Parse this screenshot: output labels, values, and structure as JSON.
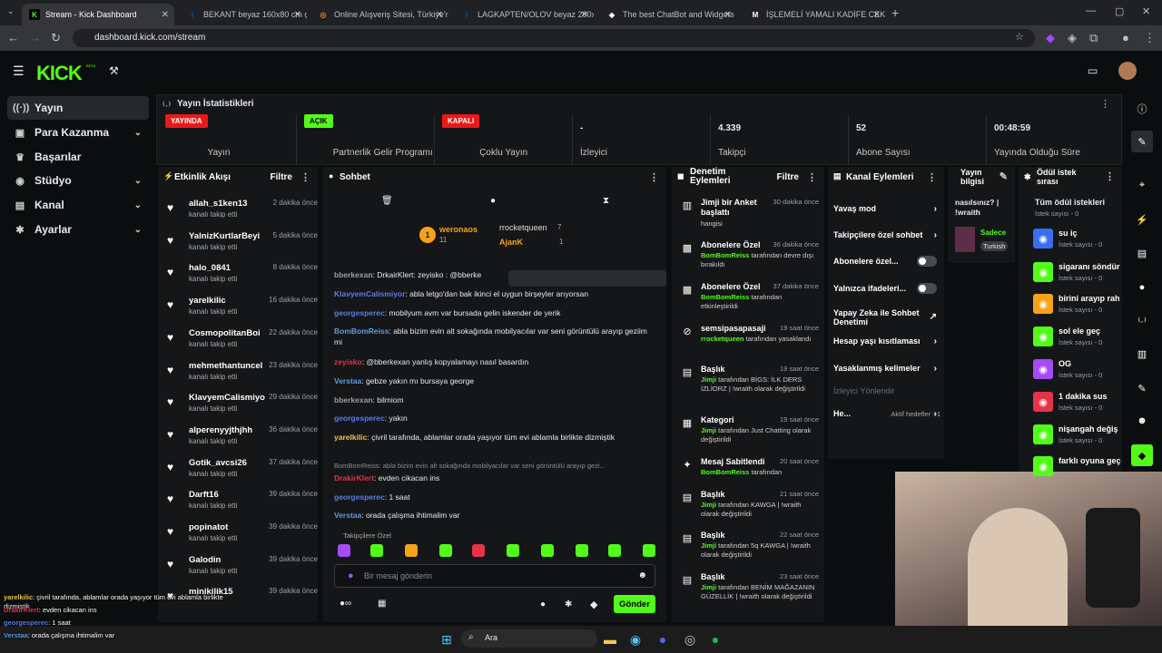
{
  "browser": {
    "tabs": [
      {
        "title": "Stream - Kick Dashboard",
        "fav": "K",
        "color": "#53fc18",
        "active": true
      },
      {
        "title": "BEKANT beyaz 160x80 cm çalış",
        "fav": "I",
        "color": "#0058a3"
      },
      {
        "title": "Online Alışveriş Sitesi, Türkiye'n",
        "fav": "◎",
        "color": "#f27a1a"
      },
      {
        "title": "LAGKAPTEN/OLOV beyaz 200x",
        "fav": "I",
        "color": "#0058a3"
      },
      {
        "title": "The best ChatBot and Widgets",
        "fav": "◆",
        "color": "#ffffff"
      },
      {
        "title": "İŞLEMELİ YAMALI KADİFE CEKE",
        "fav": "M",
        "color": "#ffffff"
      }
    ],
    "url": "dashboard.kick.com/stream"
  },
  "header": {
    "logo": "KICK",
    "beta": "BETA"
  },
  "sidebar": {
    "items": [
      {
        "label": "Yayın",
        "icon": "broadcast-icon",
        "glyph": "((·))",
        "active": true
      },
      {
        "label": "Para Kazanma",
        "icon": "money-icon",
        "glyph": "▣",
        "chev": true
      },
      {
        "label": "Başarılar",
        "icon": "trophy-icon",
        "glyph": "♛"
      },
      {
        "label": "Stüdyo",
        "icon": "studio-icon",
        "glyph": "◉",
        "chev": true
      },
      {
        "label": "Kanal",
        "icon": "channel-icon",
        "glyph": "▤",
        "chev": true
      },
      {
        "label": "Ayarlar",
        "icon": "settings-icon",
        "glyph": "✱",
        "chev": true
      }
    ]
  },
  "stats": {
    "title": "Yayın İstatistikleri",
    "items": [
      {
        "badge": "YAYINDA",
        "badge_color": "#e91916",
        "label": "Yayın"
      },
      {
        "badge": "AÇIK",
        "badge_color": "#53fc18",
        "label": "Partnerlik Gelir Programı"
      },
      {
        "badge": "KAPALI",
        "badge_color": "#e91916",
        "label": "Çoklu Yayın"
      },
      {
        "value": "-",
        "label": "İzleyici"
      },
      {
        "value": "4.339",
        "label": "Takipçi"
      },
      {
        "value": "52",
        "label": "Abone Sayısı"
      },
      {
        "value": "00:48:59",
        "label": "Yayında Olduğu Süre"
      }
    ]
  },
  "activity": {
    "title": "Etkinlik Akışı",
    "filter": "Filtre",
    "items": [
      {
        "name": "allah_s1ken13",
        "sub": "kanalı takip etti",
        "time": "2 dakika önce"
      },
      {
        "name": "YalnizKurtlarBeyi",
        "sub": "kanalı takip etti",
        "time": "5 dakika önce"
      },
      {
        "name": "halo_0841",
        "sub": "kanalı takip etti",
        "time": "8 dakika önce"
      },
      {
        "name": "yarelkilic",
        "sub": "kanalı takip etti",
        "time": "16 dakika önce"
      },
      {
        "name": "CosmopolitanBoi",
        "sub": "kanalı takip etti",
        "time": "22 dakika önce"
      },
      {
        "name": "mehmethantuncel",
        "sub": "kanalı takip etti",
        "time": "23 dakika önce"
      },
      {
        "name": "KlavyemCalismiyor",
        "sub": "kanalı takip etti",
        "time": "29 dakika önce"
      },
      {
        "name": "alperenyyjthjhh",
        "sub": "kanalı takip etti",
        "time": "36 dakika önce"
      },
      {
        "name": "Gotik_avcsi26",
        "sub": "kanalı takip etti",
        "time": "37 dakika önce"
      },
      {
        "name": "Darft16",
        "sub": "kanalı takip etti",
        "time": "39 dakika önce"
      },
      {
        "name": "popinatot",
        "sub": "kanalı takip etti",
        "time": "39 dakika önce"
      },
      {
        "name": "Galodin",
        "sub": "kanalı takip etti",
        "time": "39 dakika önce"
      },
      {
        "name": "minikilik15",
        "sub": "",
        "time": "39 dakika önce"
      }
    ]
  },
  "chat": {
    "title": "Sohbet",
    "leaderboard": [
      {
        "rank": "1",
        "name": "weronaos",
        "count": "11"
      },
      {
        "name": "rrocketqueen",
        "count": "7"
      },
      {
        "name": "AjanK",
        "count": "1"
      }
    ],
    "messages": [
      {
        "user": "bberkexan",
        "color": "#9aa0a6",
        "text": ": DrkairKlert: zeyisko : @bberke"
      },
      {
        "user": "KlavyemCalismiyor",
        "color": "#5b7ce6",
        "text": ": abla letgo'dan bak ikinci el uygun birşeyler arıyorsan"
      },
      {
        "user": "georgesperec",
        "color": "#5b7ce6",
        "text": ": mobilyum avm var bursada gelin iskender de yerik"
      },
      {
        "user": "BomBomReiss",
        "color": "#5b9de6",
        "text": ": abla bizim evin alt sokağında mobilyacılar var seni görüntülü arayıp geziim mi"
      },
      {
        "user": "zeyisko",
        "color": "#e6334a",
        "text": ": @bberkexan yanlış kopyalamayı nasıl basardın"
      },
      {
        "user": "Verstaa",
        "color": "#5b9de6",
        "text": ": gebze yakın mı bursaya george"
      },
      {
        "user": "bberkexan",
        "color": "#9aa0a6",
        "text": ": bilmiom"
      },
      {
        "user": "georgesperec",
        "color": "#5b7ce6",
        "text": ": yakın"
      },
      {
        "user": "yarelkilic",
        "color": "#e6c84a",
        "text": ": çivril tarafında, ablamlar orada yaşıyor tüm evi ablamla birlikte dizmiştik"
      },
      {
        "reply": "BomBomReiss: abla bizim evin alt sokağında mobilyacılar var seni görüntülü arayıp gezi..."
      },
      {
        "user": "DrakirKlert",
        "color": "#e6334a",
        "text": ": evden cikacan ins"
      },
      {
        "user": "georgesperec",
        "color": "#5b7ce6",
        "text": ": 1 saat"
      },
      {
        "user": "Verstaa",
        "color": "#5b9de6",
        "text": ": orada çalışma ihtimalim var"
      }
    ],
    "followers_label": "Takipçilere Özel",
    "placeholder": "Bir mesaj gönderin",
    "send": "Gönder"
  },
  "moderation": {
    "title": "Denetim Eylemleri",
    "filter": "Filtre",
    "items": [
      {
        "icon": "poll-icon",
        "glyph": "▥",
        "title": "Jimji bir Anket başlattı",
        "desc": "hangisi",
        "time": "30 dakika önce"
      },
      {
        "icon": "gift-icon",
        "glyph": "▩",
        "title": "Abonelere Özel",
        "desc_user": "BomBomReiss",
        "desc": " tarafından devre dışı bırakıldı",
        "time": "36 dakika önce"
      },
      {
        "icon": "gift-icon",
        "glyph": "▩",
        "title": "Abonelere Özel",
        "desc_user": "BomBomReiss",
        "desc": " tarafından etkinleştirildi",
        "time": "37 dakika önce"
      },
      {
        "icon": "ban-icon",
        "glyph": "⊘",
        "title": "semsipasapasaji",
        "desc_user": "rrocketqueen",
        "desc": " tarafından yasaklandı",
        "time": "19 saat önce"
      },
      {
        "icon": "title-icon",
        "glyph": "▤",
        "title": "Başlık",
        "desc_user": "Jimji",
        "desc": " tarafından BİGS: İLK DERS İZLİORZ | !wraith olarak değiştirildi",
        "time": "19 saat önce"
      },
      {
        "icon": "category-icon",
        "glyph": "▦",
        "title": "Kategori",
        "desc_user": "Jimji",
        "desc": " tarafından Just Chatting olarak değiştirildi",
        "time": "19 saat önce"
      },
      {
        "icon": "pin-icon",
        "glyph": "✦",
        "title": "Mesaj Sabitlendi",
        "desc_user": "BomBomReiss",
        "desc": " tarafından",
        "time": "20 saat önce"
      },
      {
        "icon": "title-icon",
        "glyph": "▤",
        "title": "Başlık",
        "desc_user": "Jimji",
        "desc": " tarafından KAWGA | !wraith olarak değiştirildi",
        "time": "21 saat önce"
      },
      {
        "icon": "title-icon",
        "glyph": "▤",
        "title": "Başlık",
        "desc_user": "Jimji",
        "desc": " tarafından 5q KAWGA | !wraith olarak değiştirildi",
        "time": "22 saat önce"
      },
      {
        "icon": "title-icon",
        "glyph": "▤",
        "title": "Başlık",
        "desc_user": "Jimji",
        "desc": " tarafından BENİM MAĞAZANIN GÜZELLİK | !wraith olarak değiştirildi",
        "time": "23 saat önce"
      }
    ]
  },
  "channel_actions": {
    "title": "Kanal Eylemleri",
    "items": [
      {
        "label": "Yavaş mod",
        "kind": "chev"
      },
      {
        "label": "Takipçilere özel sohbet",
        "kind": "chev"
      },
      {
        "label": "Abonelere özel...",
        "kind": "toggle"
      },
      {
        "label": "Yalnızca ifadeleri...",
        "kind": "toggle"
      },
      {
        "label": "Yapay Zeka ile Sohbet Denetimi",
        "kind": "ext"
      },
      {
        "label": "Hesap yaşı kısıtlaması",
        "kind": "chev"
      },
      {
        "label": "Yasaklanmış kelimeler",
        "kind": "chev"
      },
      {
        "label": "İzleyici Yönlendir",
        "kind": "none"
      },
      {
        "label": "He...",
        "kind": "chev",
        "extra": "Aktif hedefler - 1"
      }
    ]
  },
  "stream_info": {
    "title": "Yayın bilgisi",
    "text": "nasılsınız? | !wraith",
    "cat": "Sadece",
    "tag": "Turkish"
  },
  "rewards": {
    "title": "Ödül istek sırası",
    "all": "Tüm ödül istekleri",
    "all_sub": "İstek sayısı - 0",
    "items": [
      {
        "name": "su iç",
        "sub": "İstek sayısı - 0",
        "color": "#3a6df0"
      },
      {
        "name": "sigaranı söndür",
        "sub": "İstek sayısı - 0",
        "color": "#53fc18"
      },
      {
        "name": "birini arayıp rah",
        "sub": "İstek sayısı - 0",
        "color": "#f7a21b"
      },
      {
        "name": "sol ele geç",
        "sub": "İstek sayısı - 0",
        "color": "#53fc18"
      },
      {
        "name": "OG",
        "sub": "İstek sayısı - 0",
        "color": "#a64af5"
      },
      {
        "name": "1 dakika sus",
        "sub": "İstek sayısı - 0",
        "color": "#e6334a"
      },
      {
        "name": "nişangah değiş",
        "sub": "İstek sayısı - 0",
        "color": "#53fc18"
      },
      {
        "name": "farklı oyuna geç",
        "sub": "",
        "color": "#53fc18"
      }
    ]
  },
  "overlay": {
    "lines": [
      {
        "user": "yarelkilic",
        "text": ": çivril tarafında, ablamlar orada yaşıyor tüm evi ablamla birlikte dizmiştik",
        "user_color": "#e6c84a"
      },
      {
        "user": "DrakirKlert",
        "text": ": evden cikacan ins",
        "user_color": "#e6334a"
      },
      {
        "user": "georgesperec",
        "text": ": 1 saat",
        "user_color": "#5b7ce6"
      },
      {
        "user": "Verstaa",
        "text": ": orada çalışma ihtimalim var",
        "user_color": "#5b9de6"
      }
    ]
  },
  "taskbar": {
    "search": "Ara"
  }
}
